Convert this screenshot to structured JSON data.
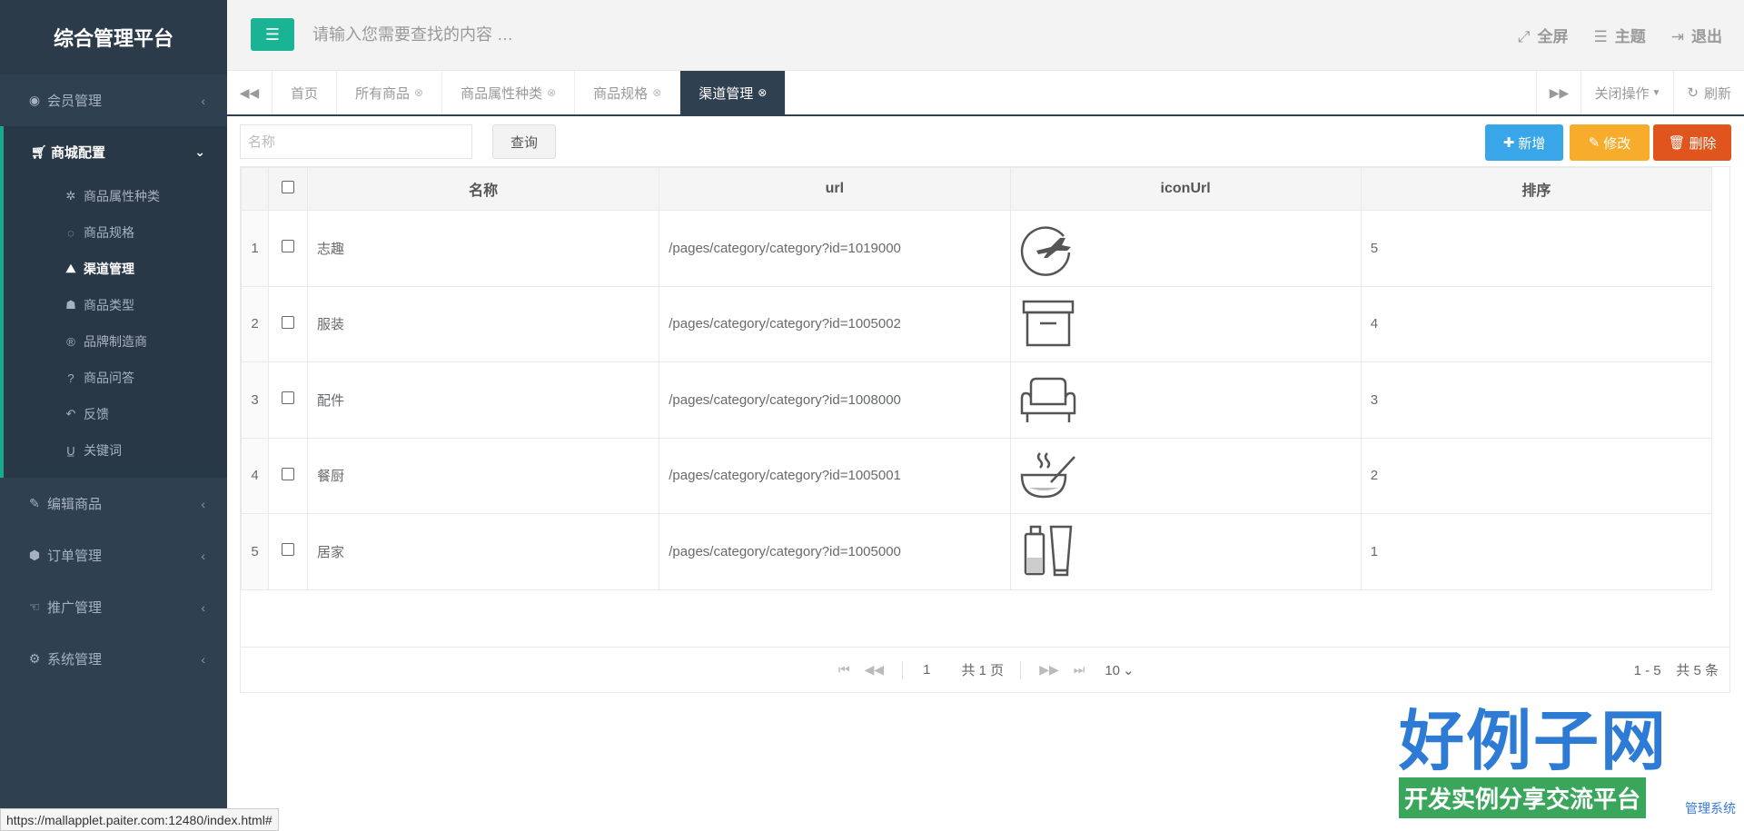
{
  "brand": "综合管理平台",
  "sidebar": {
    "groups": [
      {
        "label": "会员管理",
        "icon": "user-circle-icon"
      },
      {
        "label": "商城配置",
        "icon": "cart-icon",
        "active": true,
        "items": [
          {
            "label": "商品属性种类",
            "icon": "cog-icon"
          },
          {
            "label": "商品规格",
            "icon": "tag-icon"
          },
          {
            "label": "渠道管理",
            "icon": "road-icon",
            "current": true
          },
          {
            "label": "商品类型",
            "icon": "user-secret-icon"
          },
          {
            "label": "品牌制造商",
            "icon": "registered-icon"
          },
          {
            "label": "商品问答",
            "icon": "question-icon"
          },
          {
            "label": "反馈",
            "icon": "reply-icon"
          },
          {
            "label": "关键词",
            "icon": "underline-icon"
          }
        ]
      },
      {
        "label": "编辑商品",
        "icon": "edit-icon"
      },
      {
        "label": "订单管理",
        "icon": "cube-icon"
      },
      {
        "label": "推广管理",
        "icon": "hand-icon"
      },
      {
        "label": "系统管理",
        "icon": "gear-icon"
      }
    ]
  },
  "topbar": {
    "search_placeholder": "请输入您需要查找的内容 …",
    "fullscreen": "全屏",
    "theme": "主题",
    "logout": "退出"
  },
  "tabs": {
    "items": [
      {
        "label": "首页"
      },
      {
        "label": "所有商品"
      },
      {
        "label": "商品属性种类"
      },
      {
        "label": "商品规格"
      },
      {
        "label": "渠道管理",
        "active": true
      }
    ],
    "close_ops": "关闭操作",
    "refresh": "刷新"
  },
  "toolbar": {
    "name_placeholder": "名称",
    "query": "查询",
    "add": "新增",
    "edit": "修改",
    "delete": "删除"
  },
  "table": {
    "headers": [
      "名称",
      "url",
      "iconUrl",
      "排序"
    ],
    "rows": [
      {
        "num": "1",
        "name": "志趣",
        "url": "/pages/category/category?id=1019000",
        "icon": "plane-globe-icon",
        "sort": "5"
      },
      {
        "num": "2",
        "name": "服装",
        "url": "/pages/category/category?id=1005002",
        "icon": "storage-box-icon",
        "sort": "4"
      },
      {
        "num": "3",
        "name": "配件",
        "url": "/pages/category/category?id=1008000",
        "icon": "sofa-icon",
        "sort": "3"
      },
      {
        "num": "4",
        "name": "餐厨",
        "url": "/pages/category/category?id=1005001",
        "icon": "hot-bowl-icon",
        "sort": "2"
      },
      {
        "num": "5",
        "name": "居家",
        "url": "/pages/category/category?id=1005000",
        "icon": "bottles-icon",
        "sort": "1"
      }
    ]
  },
  "pagination": {
    "page": "1",
    "total_pages": "共 1 页",
    "page_size": "10",
    "info": "1 - 5    共 5 条"
  },
  "statusbar": "https://mallapplet.paiter.com:12480/index.html#",
  "watermark": {
    "title": "好例子网",
    "subtitle": "开发实例分享交流平台",
    "footer": "管理系统"
  }
}
